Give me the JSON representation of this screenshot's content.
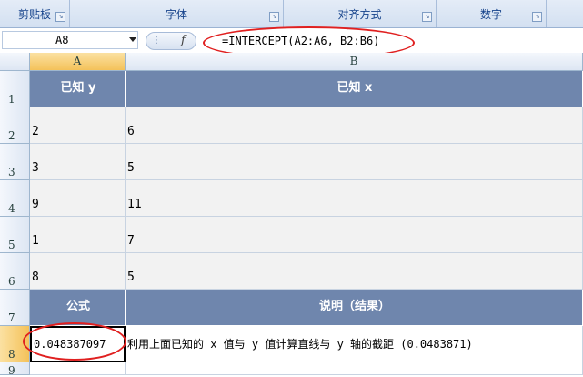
{
  "ribbon": {
    "groups": [
      {
        "label": "剪贴板"
      },
      {
        "label": "字体"
      },
      {
        "label": "对齐方式"
      },
      {
        "label": "数字"
      }
    ]
  },
  "formula_bar": {
    "name_box": "A8",
    "formula": "=INTERCEPT(A2:A6, B2:B6)"
  },
  "columns": [
    "A",
    "B"
  ],
  "rows": [
    "1",
    "2",
    "3",
    "4",
    "5",
    "6",
    "7",
    "8",
    "9"
  ],
  "table": {
    "header": {
      "a": "已知 y",
      "b": "已知 x"
    },
    "data": [
      {
        "a": "2",
        "b": "6"
      },
      {
        "a": "3",
        "b": "5"
      },
      {
        "a": "9",
        "b": "11"
      },
      {
        "a": "1",
        "b": "7"
      },
      {
        "a": "8",
        "b": "5"
      }
    ],
    "formula_header": {
      "a": "公式",
      "b": "说明（结果）"
    },
    "result": {
      "a": "0.048387097",
      "b": "利用上面已知的 x 值与 y 值计算直线与 y 轴的截距 (0.0483871)"
    }
  },
  "colors": {
    "header_bg": "#6f86ad",
    "annotation": "#e02020",
    "selection": "#f4c25a"
  }
}
